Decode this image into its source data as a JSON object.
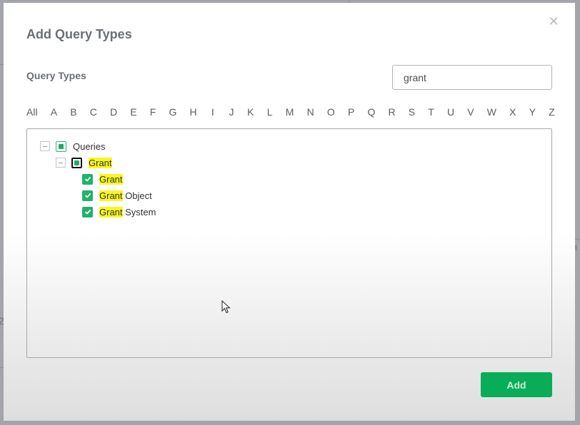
{
  "dialog": {
    "title": "Add Query Types",
    "close_icon": "close-icon"
  },
  "section": {
    "label": "Query Types"
  },
  "search": {
    "value": "grant",
    "placeholder": ""
  },
  "alphabet": [
    "All",
    "A",
    "B",
    "C",
    "D",
    "E",
    "F",
    "G",
    "H",
    "I",
    "J",
    "K",
    "L",
    "M",
    "N",
    "O",
    "P",
    "Q",
    "R",
    "S",
    "T",
    "U",
    "V",
    "W",
    "X",
    "Y",
    "Z"
  ],
  "tree": {
    "root": {
      "label": "Queries",
      "state": "partial",
      "expanded": true
    },
    "group": {
      "highlight": "Grant",
      "rest": "",
      "state": "partial",
      "expanded": true,
      "focused": true
    },
    "items": [
      {
        "highlight": "Grant",
        "rest": "",
        "state": "checked"
      },
      {
        "highlight": "Grant",
        "rest": " Object",
        "state": "checked"
      },
      {
        "highlight": "Grant",
        "rest": " System",
        "state": "checked"
      }
    ]
  },
  "footer": {
    "add_label": "Add"
  },
  "background": {
    "left_fragment": "2",
    "right_fragment": "t"
  },
  "colors": {
    "accent_green": "#09ad57",
    "highlight_yellow": "#f8f71f",
    "title_gray": "#6b6f78"
  }
}
